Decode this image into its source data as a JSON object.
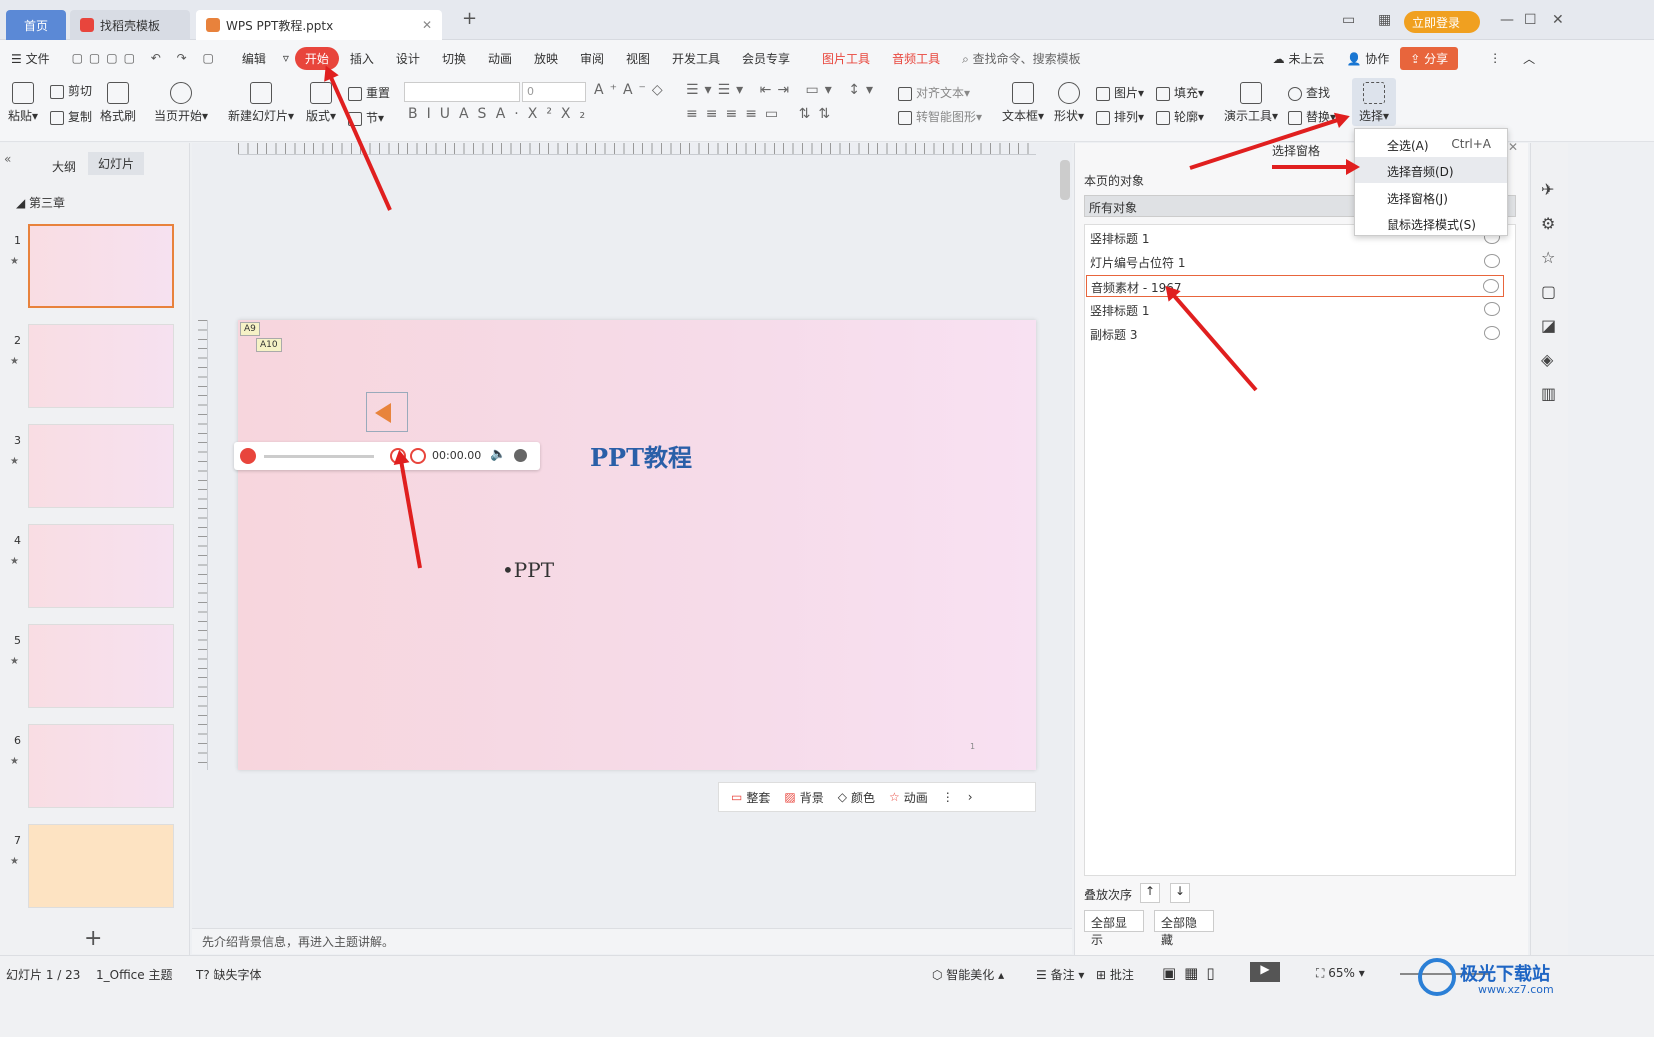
{
  "tabs": {
    "home": "首页",
    "template": "找稻壳模板",
    "doc": "WPS PPT教程.pptx",
    "login": "立即登录"
  },
  "menu": {
    "file": "文件",
    "edit": "编辑",
    "start": "开始",
    "insert": "插入",
    "design": "设计",
    "switch": "切换",
    "anim": "动画",
    "play": "放映",
    "review": "审阅",
    "view": "视图",
    "dev": "开发工具",
    "member": "会员专享",
    "pictool": "图片工具",
    "audiotool": "音频工具",
    "search": "查找命令、搜索模板",
    "cloud": "未上云",
    "collab": "协作",
    "share": "分享"
  },
  "ribbon": {
    "paste": "粘贴",
    "cut": "剪切",
    "copy": "复制",
    "format": "格式刷",
    "fromcur": "当页开始",
    "newslide": "新建幻灯片",
    "layout": "版式",
    "reset": "重置",
    "section": "节",
    "fontsize": "0",
    "aligntext": "对齐文本",
    "smartart": "转智能图形",
    "textbox": "文本框",
    "shape": "形状",
    "picture": "图片",
    "arrange": "排列",
    "fill": "填充",
    "outline": "轮廓",
    "present": "演示工具",
    "find": "查找",
    "replace": "替换",
    "select": "选择"
  },
  "left": {
    "outline": "大纲",
    "slides": "幻灯片",
    "chapter": "第三章"
  },
  "slide": {
    "title": "PPT教程",
    "bullet": "•PPT",
    "time": "00:00.00",
    "tagA9": "A9",
    "tagA10": "A10",
    "pagenum": "1"
  },
  "slidebar": {
    "theme": "整套",
    "bg": "背景",
    "color": "颜色",
    "anim": "动画"
  },
  "notes": "先介绍背景信息，再进入主题讲解。",
  "pane": {
    "title": "选择窗格",
    "objs_label": "本页的对象",
    "filter": "所有对象",
    "items": [
      "竖排标题 1",
      "灯片编号占位符 1",
      "音频素材 - 1967",
      "竖排标题 1",
      "副标题 3"
    ],
    "order": "叠放次序",
    "showall": "全部显示",
    "hideall": "全部隐藏"
  },
  "dropdown": {
    "all": "全选(A)",
    "all_key": "Ctrl+A",
    "audio": "选择音频(D)",
    "pane": "选择窗格(J)",
    "mouse": "鼠标选择模式(S)"
  },
  "status": {
    "slidecount": "幻灯片 1 / 23",
    "theme": "1_Office 主题",
    "font": "缺失字体",
    "beautify": "智能美化",
    "notes": "备注",
    "comment": "批注",
    "zoom": "65%",
    "watermark": "极光下载站",
    "watermark_url": "www.xz7.com"
  }
}
